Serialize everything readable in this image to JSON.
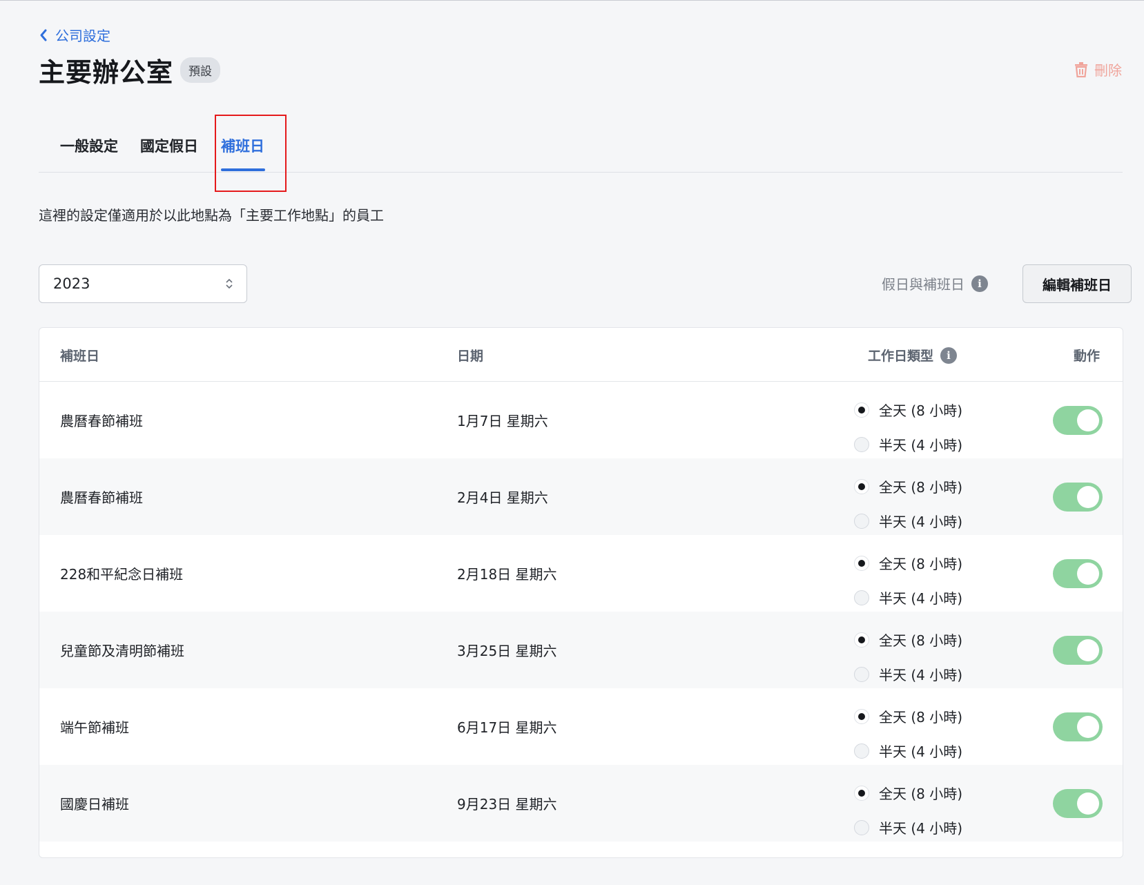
{
  "breadcrumb": {
    "back_label": "公司設定"
  },
  "header": {
    "title": "主要辦公室",
    "badge": "預設",
    "delete_label": "刪除"
  },
  "tabs": [
    {
      "label": "一般設定",
      "active": false
    },
    {
      "label": "國定假日",
      "active": false
    },
    {
      "label": "補班日",
      "active": true
    }
  ],
  "note": "這裡的設定僅適用於以此地點為「主要工作地點」的員工",
  "year_select": {
    "value": "2023"
  },
  "legend": {
    "label": "假日與補班日"
  },
  "edit_button": {
    "label": "編輯補班日"
  },
  "table": {
    "columns": {
      "name": "補班日",
      "date": "日期",
      "type": "工作日類型",
      "action": "動作"
    },
    "option_full": "全天 (8 小時)",
    "option_half": "半天 (4 小時)",
    "rows": [
      {
        "name": "農曆春節補班",
        "date": "1月7日 星期六",
        "type": "full",
        "enabled": true
      },
      {
        "name": "農曆春節補班",
        "date": "2月4日 星期六",
        "type": "full",
        "enabled": true
      },
      {
        "name": "228和平紀念日補班",
        "date": "2月18日 星期六",
        "type": "full",
        "enabled": true
      },
      {
        "name": "兒童節及清明節補班",
        "date": "3月25日 星期六",
        "type": "full",
        "enabled": true
      },
      {
        "name": "端午節補班",
        "date": "6月17日 星期六",
        "type": "full",
        "enabled": true
      },
      {
        "name": "國慶日補班",
        "date": "9月23日 星期六",
        "type": "full",
        "enabled": true
      }
    ]
  },
  "colors": {
    "accent": "#2f6fdc",
    "toggle_on": "#8fd4a0",
    "danger": "#f0a49b",
    "highlight": "#e5191b"
  }
}
